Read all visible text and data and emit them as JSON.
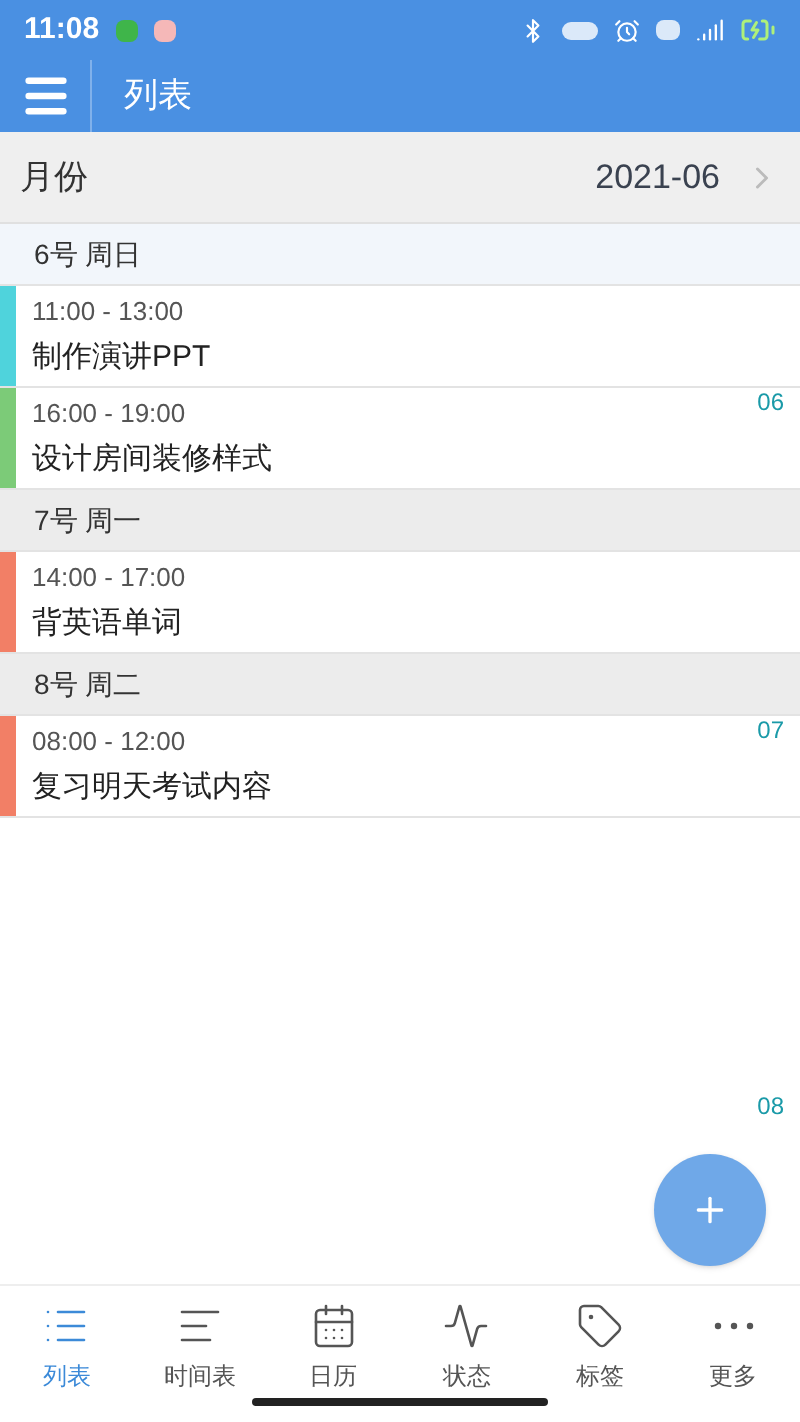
{
  "status_bar": {
    "time": "11:08"
  },
  "app_bar": {
    "title": "列表"
  },
  "month_row": {
    "label": "月份",
    "value": "2021-06"
  },
  "days": [
    {
      "header": "6号 周日",
      "selected": true,
      "events": [
        {
          "time": "11:00 - 13:00",
          "title": "制作演讲PPT",
          "color": "#4fd3dc"
        },
        {
          "time": "16:00 - 19:00",
          "title": "设计房间装修样式",
          "color": "#7ccb78",
          "week": "06"
        }
      ]
    },
    {
      "header": "7号 周一",
      "selected": false,
      "events": [
        {
          "time": "14:00 - 17:00",
          "title": "背英语单词",
          "color": "#f27f66"
        }
      ]
    },
    {
      "header": "8号 周二",
      "selected": false,
      "events": [
        {
          "time": "08:00 - 12:00",
          "title": "复习明天考试内容",
          "color": "#f27f66",
          "week": "07"
        }
      ]
    }
  ],
  "trailing_week": "08",
  "tabs": [
    {
      "label": "列表",
      "selected": true
    },
    {
      "label": "时间表",
      "selected": false
    },
    {
      "label": "日历",
      "selected": false
    },
    {
      "label": "状态",
      "selected": false
    },
    {
      "label": "标签",
      "selected": false
    },
    {
      "label": "更多",
      "selected": false
    }
  ]
}
